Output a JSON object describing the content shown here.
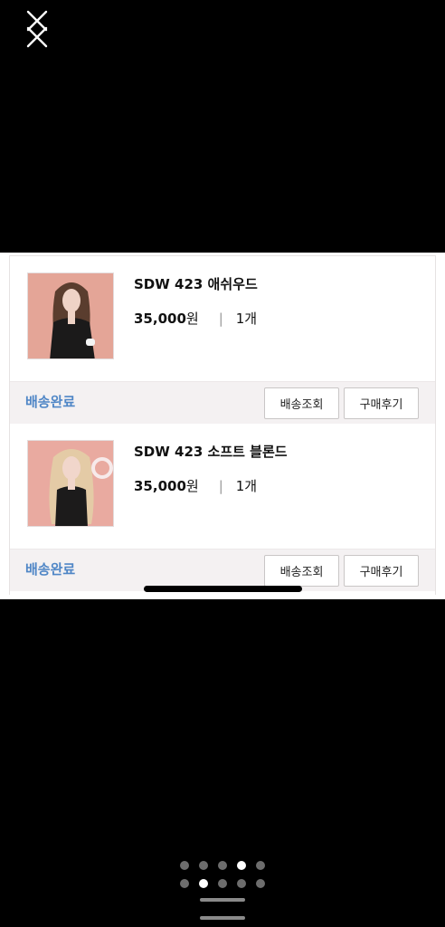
{
  "orders": [
    {
      "product_name": "SDW 423 애쉬우드",
      "price": "35,000",
      "currency": "원",
      "separator": "|",
      "quantity": "1개",
      "status": "배송완료",
      "track_label": "배송조회",
      "review_label": "구매후기"
    },
    {
      "product_name": "SDW 423 소프트 블론드",
      "price": "35,000",
      "currency": "원",
      "separator": "|",
      "quantity": "1개",
      "status": "배송완료",
      "track_label": "배송조회",
      "review_label": "구매후기"
    }
  ],
  "pager": {
    "row1_active_index": 3,
    "row2_active_index": 1,
    "dots_per_row": 5
  },
  "colors": {
    "status_blue": "#4f86c6",
    "thumb_bg": "#e7a89b"
  }
}
